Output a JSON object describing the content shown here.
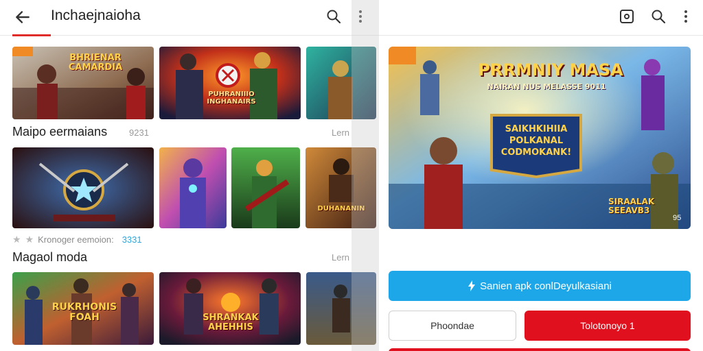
{
  "header": {
    "title": "Inchaejnaioha",
    "back_icon": "arrow-left-icon",
    "search_icon": "search-icon",
    "menu_icon": "more-vertical-icon",
    "accent": "#e02b2b"
  },
  "sections": [
    {
      "title": "Maipo eermaians",
      "count": "9231",
      "more": "Lern"
    },
    {
      "title": "Magaol moda",
      "more": "Lern"
    }
  ],
  "rating_row": {
    "text": "Kronoger eemoion:",
    "value": "3331"
  },
  "tiles": {
    "row1_t1": "BHRIENAR CAMARDIA",
    "row1_t2": "PUHRANIIIO INGHANAIRS",
    "row2_t4": "DUHANANIN",
    "row3_t1": "RUKRHONIS FOAH",
    "row3_t2": "SHRANKAK AHEHHIS"
  },
  "right": {
    "cast_icon": "cast-icon",
    "search_icon": "search-icon",
    "menu_icon": "more-vertical-icon",
    "banner": {
      "title": "PRRMNIY MASA",
      "subtitle": "NAIRAN NUS MELASSE 9011",
      "badge_line1": "SAIKHKIHIIA",
      "badge_line2": "POLKANAL",
      "badge_line3": "CODMOKANK!",
      "corner_label_1": "SIRAALAK",
      "corner_label_2": "SEEAVB3",
      "corner_num": "95"
    },
    "primary_button": "Sanien apk conlDeyulkasiani",
    "secondary_button": "Phoondae",
    "red_button": "Tolotonoyo 1",
    "colors": {
      "primary": "#1ea7e8",
      "red": "#e0101e"
    }
  }
}
